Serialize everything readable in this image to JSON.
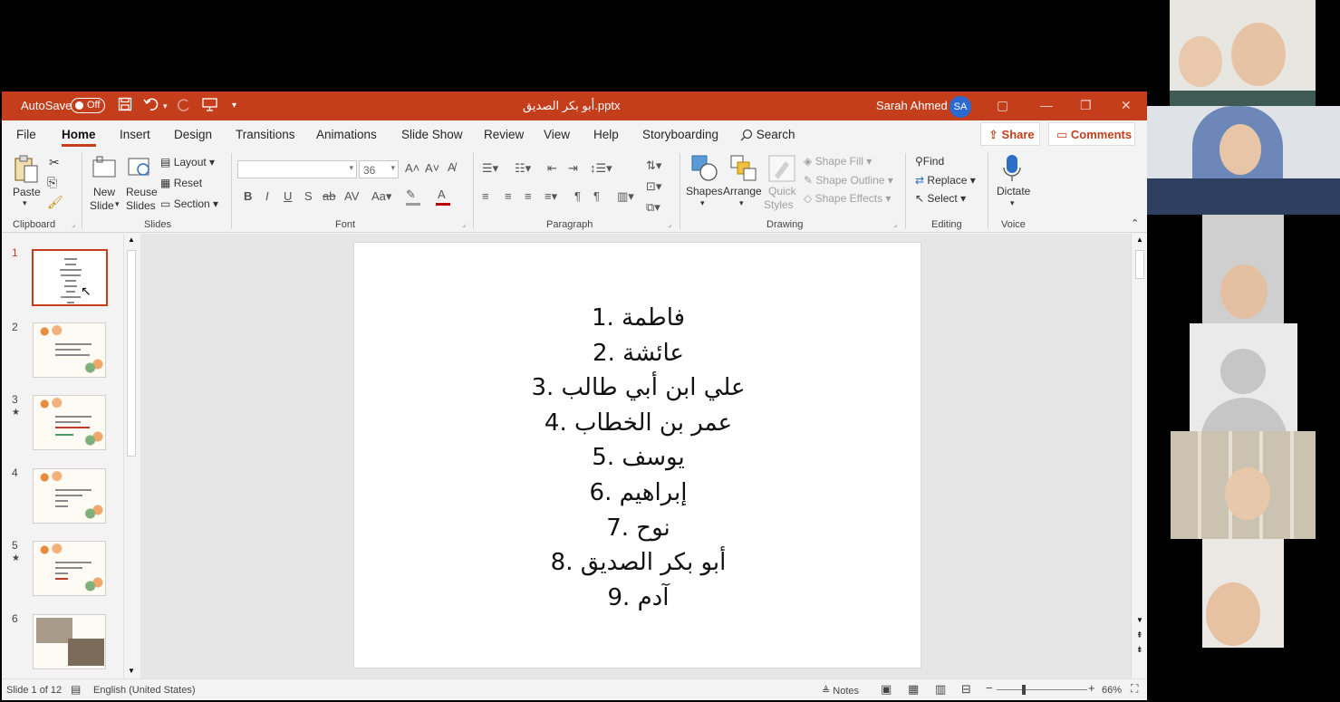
{
  "titlebar": {
    "autosave_label": "AutoSave",
    "autosave_state": "Off",
    "doc_name": "أبو بكر الصديق.pptx",
    "user_name": "Sarah Ahmed",
    "user_initials": "SA",
    "accent": "#c43e1c"
  },
  "tabs": [
    "File",
    "Home",
    "Insert",
    "Design",
    "Transitions",
    "Animations",
    "Slide Show",
    "Review",
    "View",
    "Help",
    "Storyboarding"
  ],
  "search_label": "Search",
  "share_label": "Share",
  "comments_label": "Comments",
  "ribbon": {
    "clipboard": {
      "label": "Clipboard",
      "paste": "Paste"
    },
    "slides": {
      "label": "Slides",
      "new_slide": "New",
      "new_slide_2": "Slide",
      "reuse": "Reuse",
      "reuse_2": "Slides",
      "layout": "Layout",
      "reset": "Reset",
      "section": "Section"
    },
    "font": {
      "label": "Font",
      "size": "36"
    },
    "paragraph": {
      "label": "Paragraph"
    },
    "drawing": {
      "label": "Drawing",
      "shapes": "Shapes",
      "arrange": "Arrange",
      "quick": "Quick",
      "quick_2": "Styles",
      "shape_fill": "Shape Fill",
      "shape_outline": "Shape Outline",
      "shape_effects": "Shape Effects"
    },
    "editing": {
      "label": "Editing",
      "find": "Find",
      "replace": "Replace",
      "select": "Select"
    },
    "voice": {
      "label": "Voice",
      "dictate": "Dictate"
    }
  },
  "thumbnails": [
    {
      "num": "1",
      "kind": "list",
      "active": true,
      "star": false
    },
    {
      "num": "2",
      "kind": "floral",
      "active": false,
      "star": false
    },
    {
      "num": "3",
      "kind": "floral",
      "active": false,
      "star": true
    },
    {
      "num": "4",
      "kind": "floral",
      "active": false,
      "star": false
    },
    {
      "num": "5",
      "kind": "floral",
      "active": false,
      "star": true
    },
    {
      "num": "6",
      "kind": "photo",
      "active": false,
      "star": false
    }
  ],
  "slide": {
    "items": [
      "فاطمة  .1",
      "عائشة .2",
      "علي ابن أبي طالب .3",
      "عمر بن الخطاب .4",
      "يوسف  .5",
      "إبراهيم .6",
      "نوح  .7",
      "أبو بكر الصديق .8",
      "آدم .9"
    ]
  },
  "status": {
    "slide_count": "Slide 1 of 12",
    "language": "English (United States)",
    "notes": "Notes",
    "zoom": "66%"
  }
}
